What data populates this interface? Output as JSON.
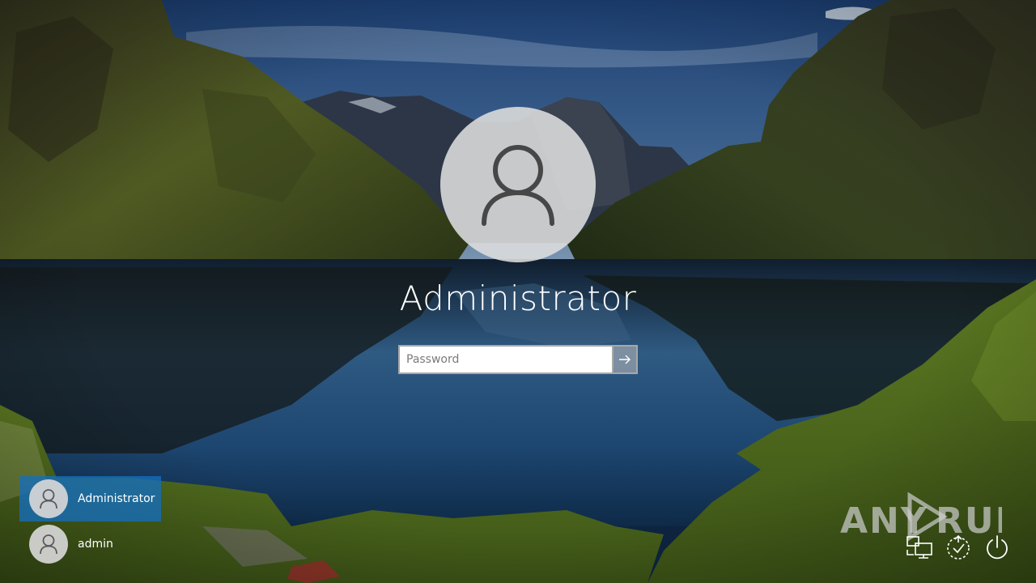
{
  "login": {
    "user_name": "Administrator",
    "password_placeholder": "Password"
  },
  "user_list": [
    {
      "name": "Administrator",
      "selected": true
    },
    {
      "name": "admin",
      "selected": false
    }
  ],
  "watermark": {
    "text_left": "ANY",
    "text_right": "RUN"
  },
  "icons": {
    "avatar": "person-icon",
    "submit": "arrow-right-icon",
    "network": "network-icon",
    "ease_of_access": "ease-of-access-icon",
    "power": "power-icon"
  },
  "colors": {
    "selected_user": "#146ebe",
    "avatar_bg": "#dedede",
    "text": "#ffffff"
  }
}
